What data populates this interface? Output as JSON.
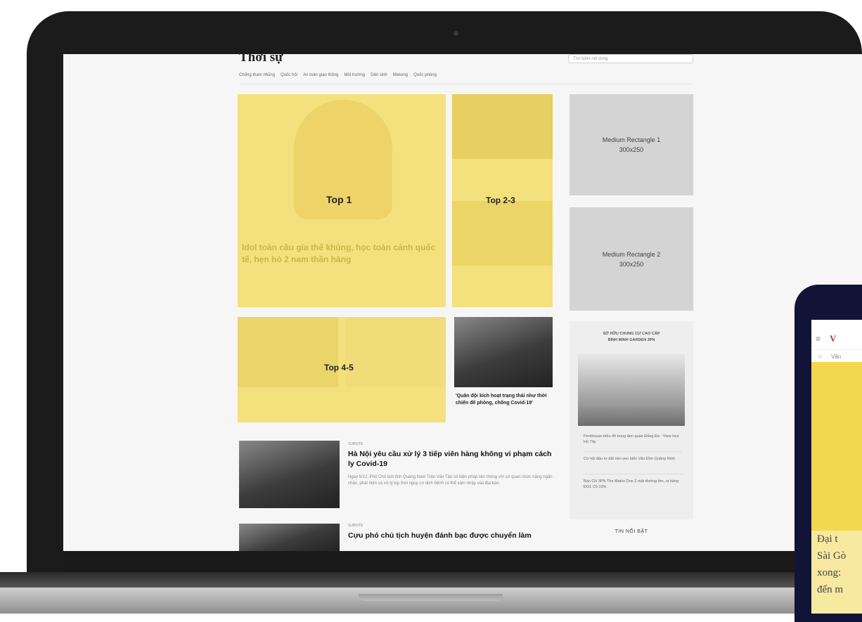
{
  "page": {
    "title": "Thời sự",
    "search_placeholder": "Tìm kiếm nội dung",
    "subnav": [
      "Chống tham nhũng",
      "Quốc hội",
      "An toàn giao thông",
      "Môi trường",
      "Dân sinh",
      "Mekong",
      "Quốc phòng"
    ]
  },
  "slots": {
    "top1": {
      "label": "Top 1",
      "headline": "Idol toàn cầu gia thế khủng, học toàn cảnh quốc tế, hẹn hò 2 nam thần hàng"
    },
    "top23": {
      "label": "Top 2-3"
    },
    "top45": {
      "label": "Top 4-5"
    },
    "medium_rect_1": {
      "line1": "Medium Rectangle 1",
      "line2": "300x250"
    },
    "medium_rect_2": {
      "line1": "Medium Rectangle 2",
      "line2": "300x250"
    }
  },
  "feature_card": {
    "title": "'Quân đội kích hoạt trạng thái như thời chiến để phòng, chống Covid-19'"
  },
  "ad_panel": {
    "title_line1": "SỞ HỮU CHUNG CƯ CAO CẤP",
    "title_line2": "BÌNH MINH GARDEN 3PN",
    "links": [
      "Penthouse triệu đô trung tâm quận Đống Đa - View trọn Hồ Tây",
      "Cơ hội đầu tư đất nền ven biển Vân Đồn Quảng Ninh",
      "Bán CH 3PN The Matrix One 2 mặt đường lớn, ra hàng ĐG1 Cô 10%"
    ]
  },
  "news": [
    {
      "category": "SUBSITE",
      "title": "Hà Nội yêu cầu xử lý 3 tiếp viên hàng không vi phạm cách ly Covid-19",
      "desc": "Ngày 5/12, Phó Chủ tịch tỉnh Quảng Nam Trần Văn Tân có biện pháp liên thông với cơ quan chức năng ngăn chặn, phát hiện và xử lý kịp thời nguy cơ dịch bệnh có thể xâm nhập vào địa bàn."
    },
    {
      "category": "SUBSITE",
      "title": "Cựu phó chủ tịch huyện đánh bạc được chuyển làm"
    }
  ],
  "trending_label": "TIN NỔI BẬT",
  "phone": {
    "logo": "V",
    "crumb": "Văn",
    "headline_lines": [
      "Đại t",
      "Sài Gò",
      "xong:",
      "đến m"
    ]
  },
  "colors": {
    "placeholder_yellow": "#f4e07c",
    "ad_gray": "#d4d4d4",
    "phone_frame": "#111437"
  }
}
